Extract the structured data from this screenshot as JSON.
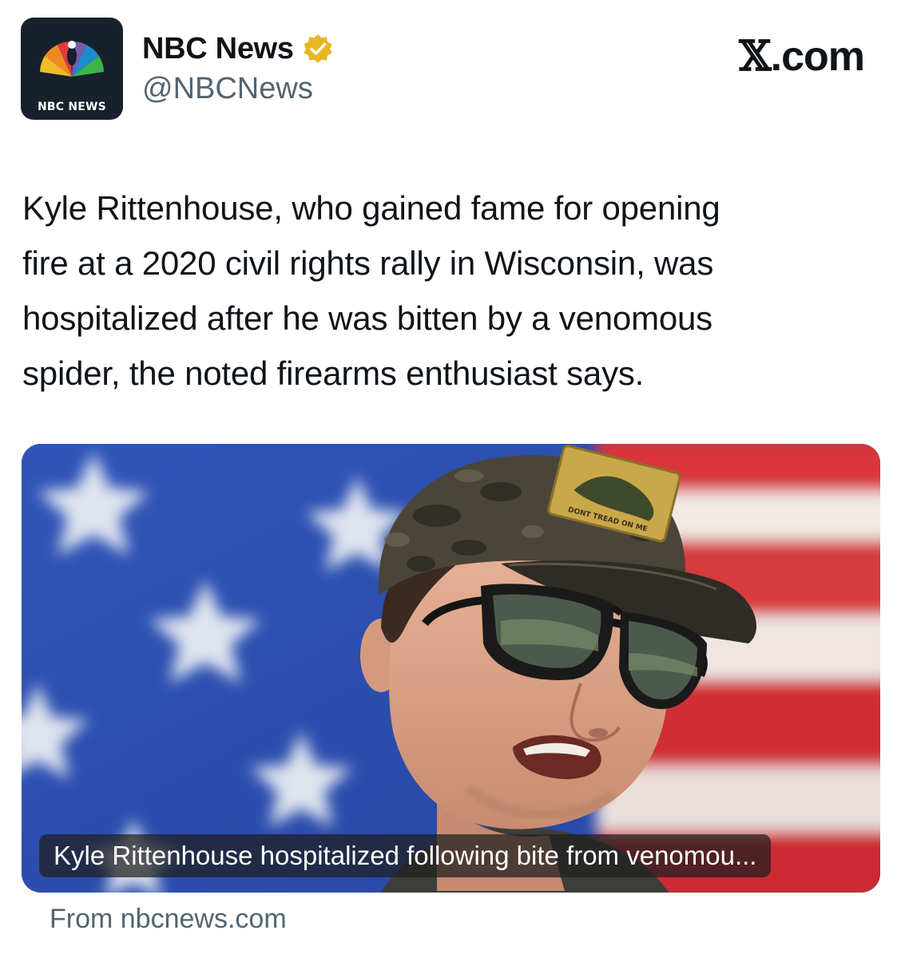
{
  "account": {
    "name": "NBC News",
    "handle": "@NBCNews",
    "logo_text": "NBC NEWS",
    "verified": true,
    "verified_color": "#e8b524"
  },
  "site": {
    "mark_x": "𝕏",
    "mark_rest": ".com"
  },
  "tweet": {
    "text_lines": [
      "Kyle Rittenhouse, who gained fame for opening",
      "fire at a 2020 civil rights rally in Wisconsin, was",
      "hospitalized after he was bitten by a venomous",
      "spider, the noted firearms enthusiast says."
    ]
  },
  "card": {
    "caption": "Kyle Rittenhouse hospitalized following bite from venomou...",
    "patch_text": "DONT TREAD ON ME",
    "source": "From nbcnews.com"
  }
}
